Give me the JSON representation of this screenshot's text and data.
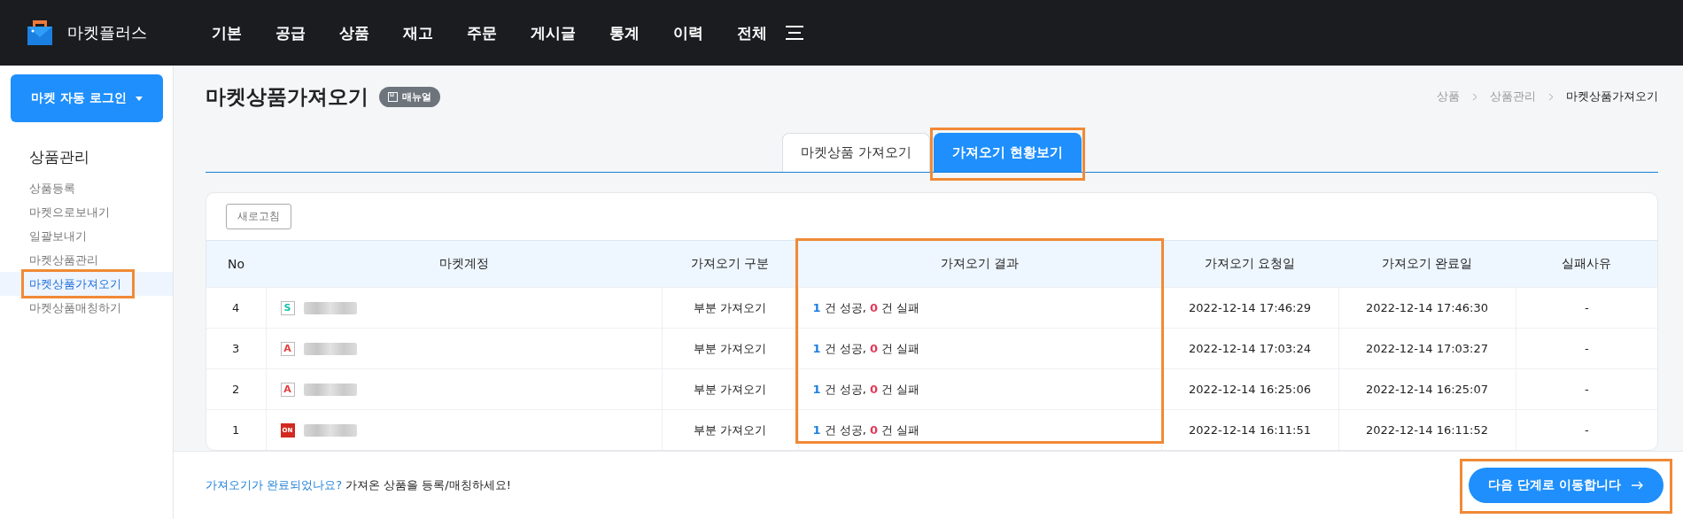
{
  "brand": {
    "name": "마켓플러스"
  },
  "nav": [
    {
      "label": "기본"
    },
    {
      "label": "공급"
    },
    {
      "label": "상품"
    },
    {
      "label": "재고"
    },
    {
      "label": "주문"
    },
    {
      "label": "게시글"
    },
    {
      "label": "통계"
    },
    {
      "label": "이력"
    },
    {
      "label": "전체"
    }
  ],
  "sidebar": {
    "login_button": "마켓 자동 로그인",
    "section": "상품관리",
    "items": [
      {
        "label": "상품등록",
        "selected": false,
        "highlighted": false
      },
      {
        "label": "마켓으로보내기",
        "selected": false,
        "highlighted": false
      },
      {
        "label": "일괄보내기",
        "selected": false,
        "highlighted": false
      },
      {
        "label": "마켓상품관리",
        "selected": false,
        "highlighted": false
      },
      {
        "label": "마켓상품가져오기",
        "selected": true,
        "highlighted": true
      },
      {
        "label": "마켓상품매칭하기",
        "selected": false,
        "highlighted": false
      }
    ]
  },
  "page": {
    "title": "마켓상품가져오기",
    "manual_badge": "매뉴얼",
    "breadcrumb": [
      "상품",
      "상품관리",
      "마켓상품가져오기"
    ]
  },
  "tabs": [
    {
      "label": "마켓상품 가져오기",
      "selected": false,
      "highlighted": false
    },
    {
      "label": "가져오기 현황보기",
      "selected": true,
      "highlighted": true
    }
  ],
  "refresh_button": "새로고침",
  "table": {
    "columns": [
      {
        "label": "No",
        "highlighted": false
      },
      {
        "label": "마켓계정",
        "highlighted": false
      },
      {
        "label": "가져오기 구분",
        "highlighted": false
      },
      {
        "label": "가져오기 결과",
        "highlighted": true
      },
      {
        "label": "가져오기 요청일",
        "highlighted": false
      },
      {
        "label": "가져오기 완료일",
        "highlighted": false
      },
      {
        "label": "실패사유",
        "highlighted": false
      }
    ],
    "rows": [
      {
        "no": "4",
        "logo": "S",
        "kind": "teal",
        "type": "부분 가져오기",
        "success": "1",
        "success_label": "건 성공,",
        "fail": "0",
        "fail_label": "건 실패",
        "requested": "2022-12-14 17:46:29",
        "completed": "2022-12-14 17:46:30",
        "reason": "-"
      },
      {
        "no": "3",
        "logo": "A",
        "kind": "red-outline",
        "type": "부분 가져오기",
        "success": "1",
        "success_label": "건 성공,",
        "fail": "0",
        "fail_label": "건 실패",
        "requested": "2022-12-14 17:03:24",
        "completed": "2022-12-14 17:03:27",
        "reason": "-"
      },
      {
        "no": "2",
        "logo": "A",
        "kind": "red-outline",
        "type": "부분 가져오기",
        "success": "1",
        "success_label": "건 성공,",
        "fail": "0",
        "fail_label": "건 실패",
        "requested": "2022-12-14 16:25:06",
        "completed": "2022-12-14 16:25:07",
        "reason": "-"
      },
      {
        "no": "1",
        "logo": "ON",
        "kind": "red-fill",
        "type": "부분 가져오기",
        "success": "1",
        "success_label": "건 성공,",
        "fail": "0",
        "fail_label": "건 실패",
        "requested": "2022-12-14 16:11:51",
        "completed": "2022-12-14 16:11:52",
        "reason": "-"
      }
    ]
  },
  "footer": {
    "link": "가져오기가 완료되었나요?",
    "message": "가져온 상품을 등록/매칭하세요!",
    "next_button": "다음 단계로 이동합니다",
    "next_highlighted": true
  }
}
